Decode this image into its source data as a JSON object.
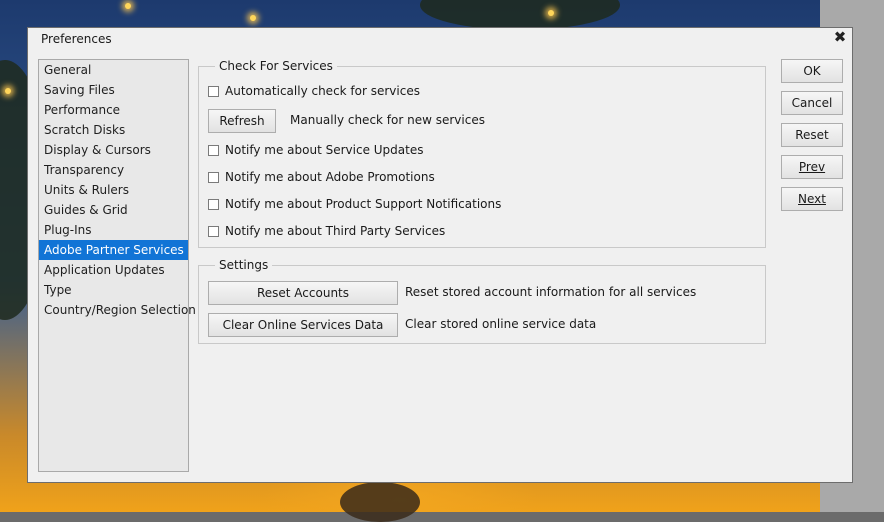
{
  "window": {
    "title": "Preferences",
    "close_glyph": "✖"
  },
  "sidebar": {
    "items": [
      {
        "label": "General"
      },
      {
        "label": "Saving Files"
      },
      {
        "label": "Performance"
      },
      {
        "label": "Scratch Disks"
      },
      {
        "label": "Display & Cursors"
      },
      {
        "label": "Transparency"
      },
      {
        "label": "Units & Rulers"
      },
      {
        "label": "Guides & Grid"
      },
      {
        "label": "Plug-Ins"
      },
      {
        "label": "Adobe Partner Services",
        "selected": true
      },
      {
        "label": "Application Updates"
      },
      {
        "label": "Type"
      },
      {
        "label": "Country/Region Selection"
      }
    ]
  },
  "check_for_services": {
    "title": "Check For Services",
    "auto_check": "Automatically check for services",
    "refresh_button": "Refresh",
    "refresh_desc": "Manually check for new services",
    "notify_updates": "Notify me about Service Updates",
    "notify_promotions": "Notify me about Adobe Promotions",
    "notify_support": "Notify me about Product Support Notifications",
    "notify_third_party": "Notify me about Third Party Services"
  },
  "settings": {
    "title": "Settings",
    "reset_accounts_button": "Reset Accounts",
    "reset_accounts_desc": "Reset stored account information for all services",
    "clear_data_button": "Clear Online Services Data",
    "clear_data_desc": "Clear stored online service data"
  },
  "actions": {
    "ok": "OK",
    "cancel": "Cancel",
    "reset": "Reset",
    "prev": "Prev",
    "next": "Next"
  },
  "colors": {
    "selection": "#1174d6",
    "dialog_bg": "#f0f0f0"
  }
}
